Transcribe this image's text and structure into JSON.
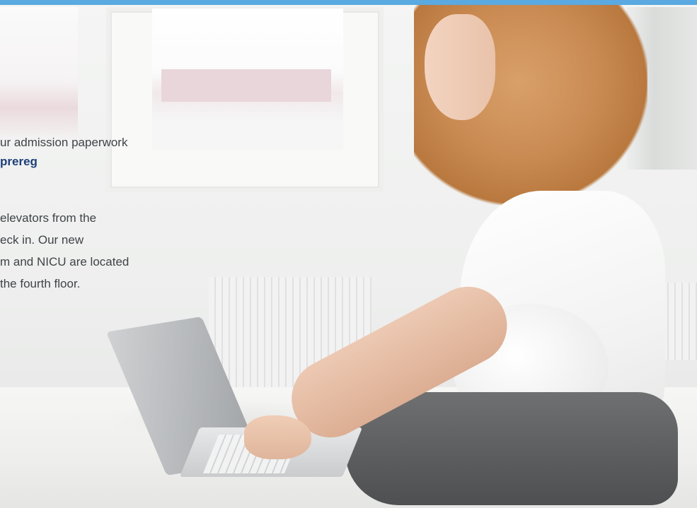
{
  "page": {
    "accent_bar_color": "#5aa9e0",
    "link_color": "#1e3f7a",
    "text_color": "#3f4448"
  },
  "copy": {
    "paragraph1": {
      "line1": "ur admission paperwork",
      "link": "prereg"
    },
    "paragraph2": {
      "line1": "elevators from the",
      "line2": "eck in. Our new",
      "line3": "m and NICU are located",
      "line4": "the fourth floor."
    }
  },
  "photo": {
    "subject": "woman-using-laptop-on-bed"
  }
}
